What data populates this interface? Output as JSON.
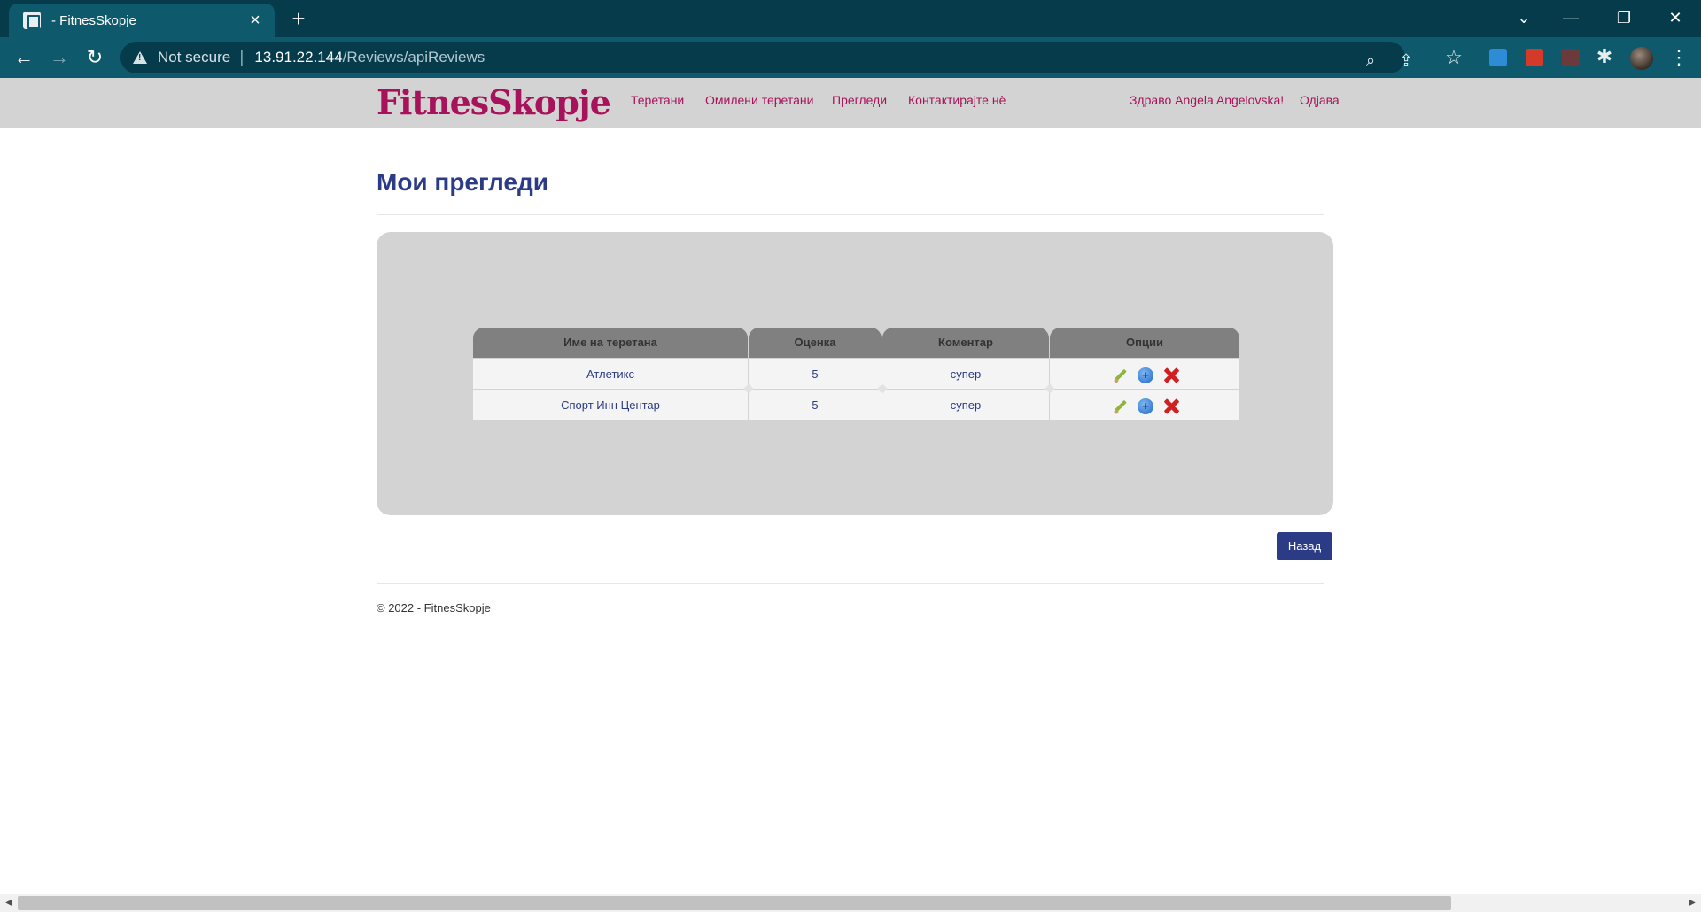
{
  "browser": {
    "tab_title": "- FitnesSkopje",
    "tab_close": "×",
    "new_tab": "+",
    "security_label": "Not secure",
    "url_host": "13.91.22.144",
    "url_path": "/Reviews/apiReviews",
    "window_controls": {
      "dropdown": "⌄",
      "minimize": "—",
      "restore": "❐",
      "close": "✕"
    },
    "nav": {
      "back": "←",
      "forward": "→",
      "reload": "↻"
    },
    "icons": {
      "zoom": "⌕",
      "share": "⇪",
      "bookmark": "☆",
      "extensions": "✱",
      "menu": "⋮"
    },
    "extension_colors": [
      "#2e8bd6",
      "#d43a2a",
      "#6b3b3b"
    ]
  },
  "site": {
    "logo": "FitnesSkopje",
    "nav": [
      "Теретани",
      "Омилени теретани",
      "Прегледи",
      "Контактирајте нè"
    ],
    "greeting": "Здраво Angela Angelovska!",
    "logout": "Одјава",
    "brand_color": "#a8125a"
  },
  "page": {
    "title": "Мои прегледи",
    "table": {
      "headers": [
        "Име на теретана",
        "Оценка",
        "Коментар",
        "Опции"
      ],
      "rows": [
        {
          "gym": "Атлетикс",
          "rating": "5",
          "comment": "супер"
        },
        {
          "gym": "Спорт Инн Центар",
          "rating": "5",
          "comment": "супер"
        }
      ]
    },
    "back_button": "Назад",
    "footer": "© 2022 - FitnesSkopje"
  }
}
